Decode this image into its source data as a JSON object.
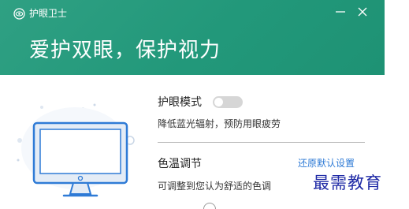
{
  "window": {
    "title": "护眼卫士",
    "accent_color": "#22987a",
    "logo_icon": "eye-shield-icon",
    "minimize_icon": "minimize-icon",
    "close_icon": "close-icon"
  },
  "banner": {
    "slogan": "爱护双眼，保护视力"
  },
  "illustration": {
    "icon": "monitor-icon"
  },
  "eye_mode": {
    "label": "护眼模式",
    "enabled": false,
    "description": "降低蓝光辐射，预防用眼疲劳"
  },
  "color_temp": {
    "label": "色温调节",
    "restore_link": "还原默认设置",
    "description": "可调整到您认为舒适的色调",
    "link_color": "#2f7bd6"
  },
  "watermark": {
    "text": "最需教育"
  }
}
